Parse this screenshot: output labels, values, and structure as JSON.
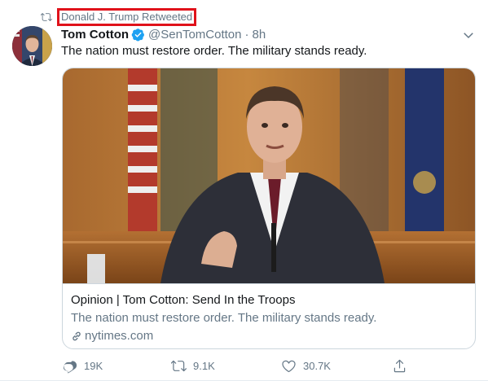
{
  "retweet_banner": {
    "text": "Donald J. Trump Retweeted",
    "highlight_color": "#e0121b"
  },
  "tweet": {
    "author_name": "Tom Cotton",
    "verified": true,
    "handle": "@SenTomCotton",
    "separator": "·",
    "time": "8h",
    "text": "The nation must restore order. The military stands ready."
  },
  "card": {
    "title": "Opinion | Tom Cotton: Send In the Troops",
    "description": "The nation must restore order. The military stands ready.",
    "domain": "nytimes.com"
  },
  "actions": {
    "replies": "19K",
    "retweets": "9.1K",
    "likes": "30.7K"
  },
  "colors": {
    "text_primary": "#14171a",
    "text_secondary": "#657786",
    "verified_blue": "#1da1f2",
    "border": "#ccd6dd"
  },
  "icons": [
    "retweet-icon",
    "verified-badge-icon",
    "chevron-down-icon",
    "link-icon",
    "reply-icon",
    "retweet-action-icon",
    "like-icon",
    "share-icon"
  ]
}
